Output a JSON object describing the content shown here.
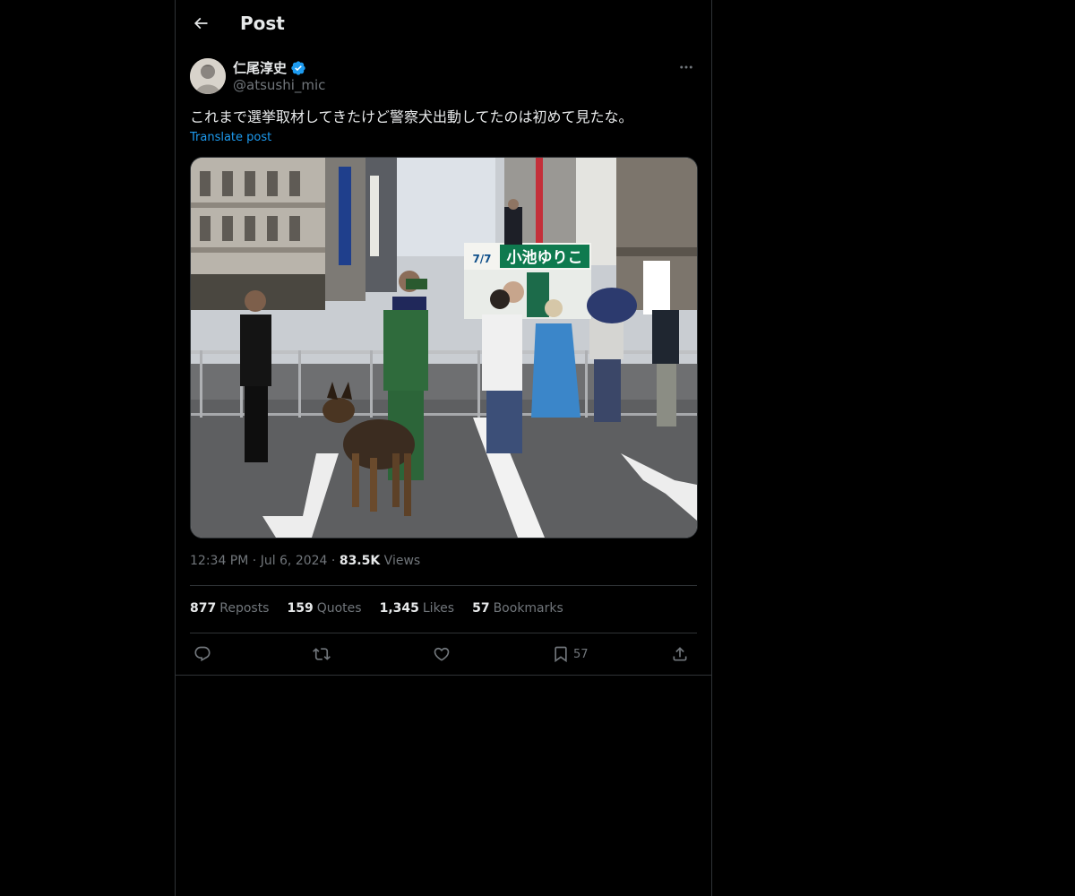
{
  "header": {
    "title": "Post"
  },
  "author": {
    "display_name": "仁尾淳史",
    "handle": "@atsushi_mic",
    "verified": true
  },
  "post": {
    "text": "これまで選挙取材してきたけど警察犬出動してたのは初めて見たな。",
    "translate_label": "Translate post",
    "image_sign_text": "小池ゆりこ",
    "image_sign_date": "7/7",
    "time": "12:34 PM",
    "date": "Jul 6, 2024",
    "views_count": "83.5K",
    "views_label": "Views"
  },
  "stats": {
    "reposts_count": "877",
    "reposts_label": "Reposts",
    "quotes_count": "159",
    "quotes_label": "Quotes",
    "likes_count": "1,345",
    "likes_label": "Likes",
    "bookmarks_count": "57",
    "bookmarks_label": "Bookmarks"
  },
  "actions": {
    "bookmark_count": "57",
    "icons": [
      "reply-icon",
      "repost-icon",
      "like-icon",
      "bookmark-icon",
      "share-icon"
    ]
  },
  "colors": {
    "background": "#000000",
    "text": "#e7e9ea",
    "muted": "#71767b",
    "accent": "#1d9bf0",
    "border": "#2f3336"
  }
}
